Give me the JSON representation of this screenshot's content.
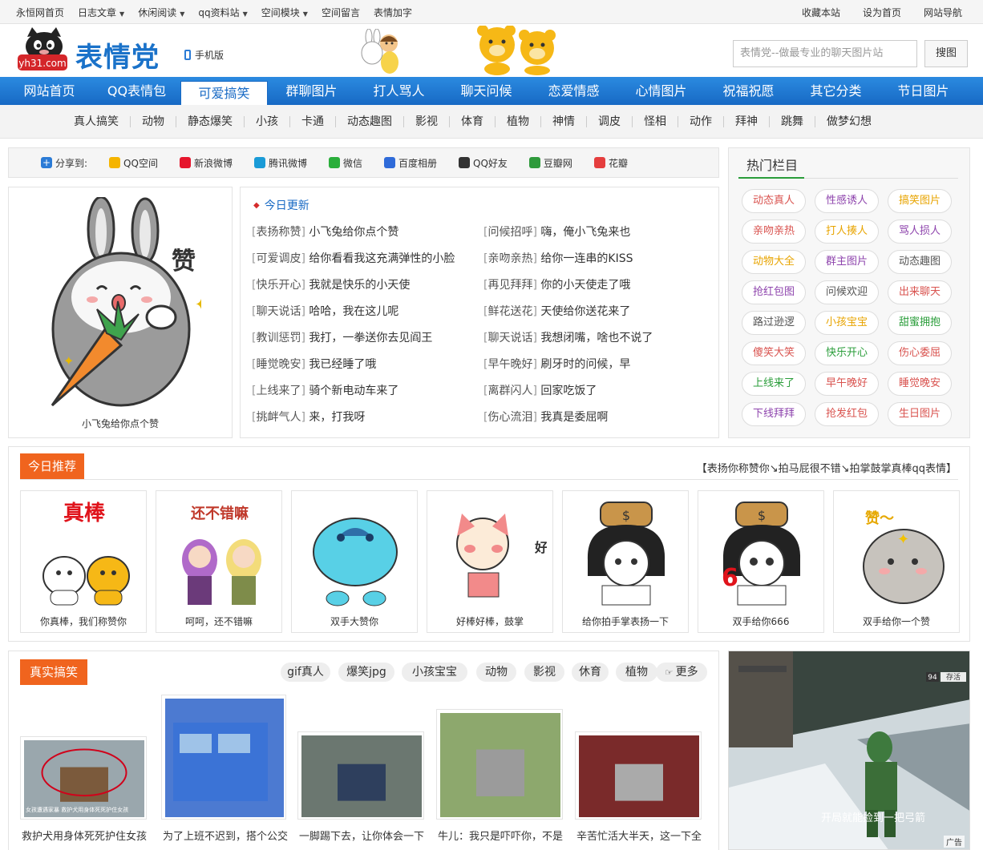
{
  "topbar": {
    "left": [
      {
        "label": "永恒网首页",
        "dropdown": false
      },
      {
        "label": "日志文章",
        "dropdown": true
      },
      {
        "label": "休闲阅读",
        "dropdown": true
      },
      {
        "label": "qq资料站",
        "dropdown": true
      },
      {
        "label": "空间模块",
        "dropdown": true
      },
      {
        "label": "空间留言",
        "dropdown": false
      },
      {
        "label": "表情加字",
        "dropdown": false
      }
    ],
    "right": [
      "收藏本站",
      "设为首页",
      "网站导航"
    ]
  },
  "header": {
    "logo_badge": "yh31.com",
    "logo_text": "表情党",
    "mobile_label": "手机版",
    "search_placeholder": "表情党--做最专业的聊天图片站",
    "search_button": "搜图"
  },
  "mainnav": [
    "网站首页",
    "QQ表情包",
    "可爱搞笑",
    "群聊图片",
    "打人骂人",
    "聊天问候",
    "恋爱情感",
    "心情图片",
    "祝福祝愿",
    "其它分类",
    "节日图片"
  ],
  "mainnav_active": 2,
  "subnav": [
    "真人搞笑",
    "动物",
    "静态爆笑",
    "小孩",
    "卡通",
    "动态趣图",
    "影视",
    "体育",
    "植物",
    "神情",
    "调皮",
    "怪相",
    "动作",
    "拜神",
    "跳舞",
    "做梦幻想"
  ],
  "share": {
    "label": "分享到:",
    "items": [
      {
        "name": "QQ空间",
        "color": "#f5b400"
      },
      {
        "name": "新浪微博",
        "color": "#e6162d"
      },
      {
        "name": "腾讯微博",
        "color": "#1a9bd7"
      },
      {
        "name": "微信",
        "color": "#2aae3b"
      },
      {
        "name": "百度相册",
        "color": "#2f6bd9"
      },
      {
        "name": "QQ好友",
        "color": "#333333"
      },
      {
        "name": "豆瓣网",
        "color": "#2f9a3c"
      },
      {
        "name": "花瓣",
        "color": "#e53e3e"
      }
    ]
  },
  "feature": {
    "caption": "小飞兔给你点个赞",
    "glyph": "赞"
  },
  "updates": {
    "title": "今日更新",
    "items": [
      {
        "cat": "表扬称赞",
        "text": "小飞兔给你点个赞"
      },
      {
        "cat": "问候招呼",
        "text": "嗨，俺小飞兔来也"
      },
      {
        "cat": "可爱调皮",
        "text": "给你看看我这充满弹性的小脸"
      },
      {
        "cat": "亲吻亲热",
        "text": "给你一连串的KISS"
      },
      {
        "cat": "快乐开心",
        "text": "我就是快乐的小天使"
      },
      {
        "cat": "再见拜拜",
        "text": "你的小天使走了哦"
      },
      {
        "cat": "聊天说话",
        "text": "哈哈，我在这儿呢"
      },
      {
        "cat": "鲜花送花",
        "text": "天使给你送花来了"
      },
      {
        "cat": "教训惩罚",
        "text": "我打，一拳送你去见阎王"
      },
      {
        "cat": "聊天说话",
        "text": "我想闭嘴，啥也不说了"
      },
      {
        "cat": "睡觉晚安",
        "text": "我已经睡了哦"
      },
      {
        "cat": "早午晚好",
        "text": "刷牙时的问候，早"
      },
      {
        "cat": "上线来了",
        "text": "骑个新电动车来了"
      },
      {
        "cat": "离群闪人",
        "text": "回家吃饭了"
      },
      {
        "cat": "挑衅气人",
        "text": "来，打我呀"
      },
      {
        "cat": "伤心流泪",
        "text": "我真是委屈啊"
      }
    ]
  },
  "hot": {
    "title": "热门栏目",
    "tags": [
      {
        "label": "动态真人",
        "color": "#d9534f"
      },
      {
        "label": "性感诱人",
        "color": "#8e44ad"
      },
      {
        "label": "搞笑图片",
        "color": "#e8a400"
      },
      {
        "label": "亲吻亲热",
        "color": "#d9534f"
      },
      {
        "label": "打人揍人",
        "color": "#e8a400"
      },
      {
        "label": "骂人损人",
        "color": "#8e44ad"
      },
      {
        "label": "动物大全",
        "color": "#e8a400"
      },
      {
        "label": "群主图片",
        "color": "#8e44ad"
      },
      {
        "label": "动态趣图",
        "color": "#555555"
      },
      {
        "label": "抢红包图",
        "color": "#8e44ad"
      },
      {
        "label": "问候欢迎",
        "color": "#555555"
      },
      {
        "label": "出来聊天",
        "color": "#d9534f"
      },
      {
        "label": "路过逊逻",
        "color": "#555555"
      },
      {
        "label": "小孩宝宝",
        "color": "#e8a400"
      },
      {
        "label": "甜蜜拥抱",
        "color": "#2a9d3a"
      },
      {
        "label": "傻笑大笑",
        "color": "#d9534f"
      },
      {
        "label": "快乐开心",
        "color": "#2a9d3a"
      },
      {
        "label": "伤心委屈",
        "color": "#d9534f"
      },
      {
        "label": "上线来了",
        "color": "#2a9d3a"
      },
      {
        "label": "早午晚好",
        "color": "#d9534f"
      },
      {
        "label": "睡觉晚安",
        "color": "#d9534f"
      },
      {
        "label": "下线拜拜",
        "color": "#8e44ad"
      },
      {
        "label": "抢发红包",
        "color": "#d9534f"
      },
      {
        "label": "生日图片",
        "color": "#d9534f"
      }
    ]
  },
  "recommend": {
    "title": "今日推荐",
    "subtitle": "【表扬你称赞你↘拍马屁很不错↘拍掌鼓掌真棒qq表情】",
    "cards": [
      {
        "caption": "你真棒，我们称赞你",
        "art": "真棒"
      },
      {
        "caption": "呵呵，还不错嘛",
        "art": "还不错嘛"
      },
      {
        "caption": "双手大赞你",
        "art": ""
      },
      {
        "caption": "好棒好棒，鼓掌",
        "art": "好棒"
      },
      {
        "caption": "给你拍手掌表扬一下",
        "art": ""
      },
      {
        "caption": "双手给你666",
        "art": "6"
      },
      {
        "caption": "双手给你一个赞",
        "art": "赞～"
      }
    ]
  },
  "funny": {
    "title": "真实搞笑",
    "tabs": [
      "gif真人",
      "爆笑jpg",
      "小孩宝宝",
      "动物",
      "影视",
      "休育",
      "植物",
      "更多"
    ],
    "items": [
      {
        "caption": "救护犬用身体死死护住女孩",
        "overlay": "女孩遭遇家暴 救护犬用身体死死护住女孩"
      },
      {
        "caption": "为了上班不迟到，搭个公交"
      },
      {
        "caption": "一脚踢下去，让你体会一下"
      },
      {
        "caption": "牛儿：我只是吓吓你，不是"
      },
      {
        "caption": "辛苦忙活大半天，这一下全"
      }
    ]
  },
  "ad": {
    "label": "广告",
    "game_text": "开局就能捡到一把弓箭",
    "score": "94",
    "hud": "存活"
  }
}
